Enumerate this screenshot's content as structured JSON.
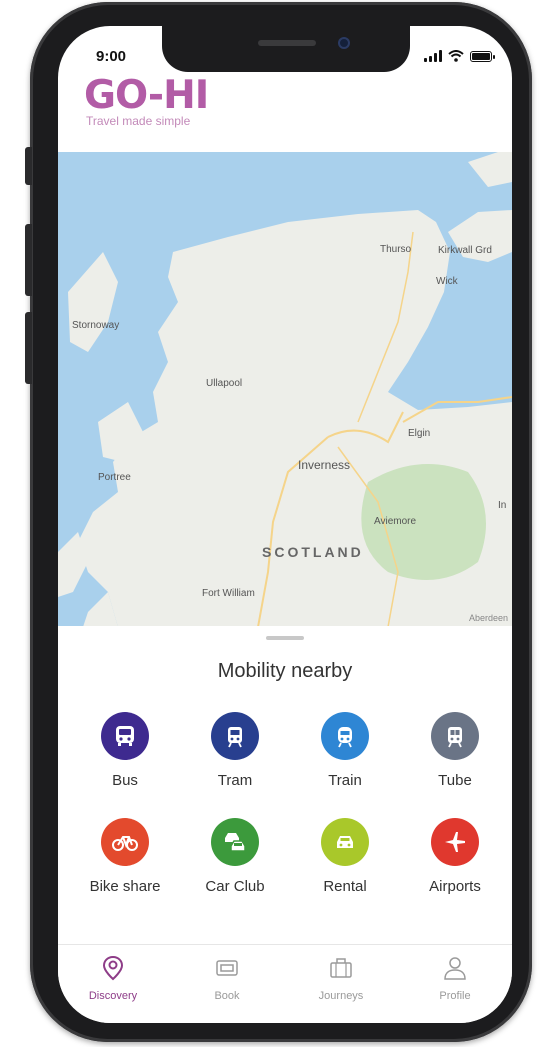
{
  "status_bar": {
    "time": "9:00"
  },
  "brand": {
    "logo_text": "GO-HI",
    "tagline": "Travel made simple",
    "accent": "#8e3d88"
  },
  "map": {
    "places": [
      "Thurso",
      "Kirkwall Grd",
      "Wick",
      "Stornoway",
      "Ullapool",
      "Elgin",
      "Inverness",
      "Portree",
      "Aviemore",
      "SCOTLAND",
      "Fort William",
      "In",
      "Aberdeen"
    ]
  },
  "mobility": {
    "title": "Mobility nearby",
    "modes": [
      {
        "label": "Bus",
        "icon": "bus-icon",
        "color": "#3e2a8f"
      },
      {
        "label": "Tram",
        "icon": "tram-icon",
        "color": "#283f8f"
      },
      {
        "label": "Train",
        "icon": "train-icon",
        "color": "#2e86d4"
      },
      {
        "label": "Tube",
        "icon": "tube-icon",
        "color": "#6a7486"
      },
      {
        "label": "Bike share",
        "icon": "bike-icon",
        "color": "#e34a2d"
      },
      {
        "label": "Car Club",
        "icon": "car-club-icon",
        "color": "#3c9a3c"
      },
      {
        "label": "Rental",
        "icon": "rental-car-icon",
        "color": "#a9c82a"
      },
      {
        "label": "Airports",
        "icon": "plane-icon",
        "color": "#e0382e"
      }
    ]
  },
  "tabbar": {
    "items": [
      {
        "label": "Discovery",
        "icon": "location-search-icon",
        "active": true
      },
      {
        "label": "Book",
        "icon": "ticket-icon",
        "active": false
      },
      {
        "label": "Journeys",
        "icon": "briefcase-icon",
        "active": false
      },
      {
        "label": "Profile",
        "icon": "user-icon",
        "active": false
      }
    ]
  }
}
